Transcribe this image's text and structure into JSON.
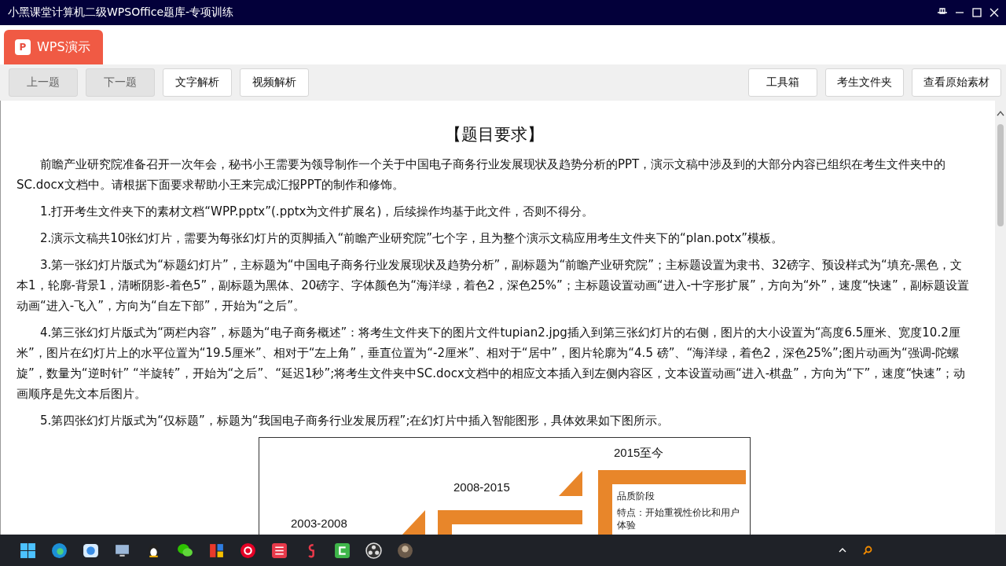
{
  "window": {
    "title": "小黑课堂计算机二级WPSOffice题库-专项训练"
  },
  "app_tab": {
    "label": "WPS演示",
    "icon_letter": "P"
  },
  "toolbar": {
    "left": [
      {
        "label": "上一题",
        "disabled": true
      },
      {
        "label": "下一题",
        "disabled": true
      },
      {
        "label": "文字解析",
        "disabled": false
      },
      {
        "label": "视频解析",
        "disabled": false
      }
    ],
    "right": [
      {
        "label": "工具箱",
        "disabled": false
      },
      {
        "label": "考生文件夹",
        "disabled": false
      },
      {
        "label": "查看原始素材",
        "disabled": false
      }
    ]
  },
  "document": {
    "heading": "【题目要求】",
    "paragraphs": [
      "前瞻产业研究院准备召开一次年会，秘书小王需要为领导制作一个关于中国电子商务行业发展现状及趋势分析的PPT，演示文稿中涉及到的大部分内容已组织在考生文件夹中的SC.docx文档中。请根据下面要求帮助小王来完成汇报PPT的制作和修饰。",
      "1.打开考生文件夹下的素材文档“WPP.pptx”(.pptx为文件扩展名)，后续操作均基于此文件，否则不得分。",
      "2.演示文稿共10张幻灯片，需要为每张幻灯片的页脚插入“前瞻产业研究院”七个字，且为整个演示文稿应用考生文件夹下的“plan.potx”模板。",
      "3.第一张幻灯片版式为“标题幻灯片”，主标题为“中国电子商务行业发展现状及趋势分析”，副标题为“前瞻产业研究院”；主标题设置为隶书、32磅字、预设样式为“填充-黑色，文本1，轮廓-背景1，清晰阴影-着色5”，副标题为黑体、20磅字、字体颜色为“海洋绿，着色2，深色25%”；主标题设置动画“进入-十字形扩展”，方向为“外”，速度“快速”，副标题设置动画“进入-飞入”，方向为“自左下部”，开始为“之后”。",
      "4.第三张幻灯片版式为“两栏内容”，标题为“电子商务概述”：将考生文件夹下的图片文件tupian2.jpg插入到第三张幻灯片的右侧，图片的大小设置为“高度6.5厘米、宽度10.2厘米”，图片在幻灯片上的水平位置为“19.5厘米”、相对于“左上角”，垂直位置为“-2厘米”、相对于“居中”，图片轮廓为“4.5 磅”、“海洋绿，着色2，深色25%”;图片动画为“强调-陀螺旋”，数量为“逆时针” “半旋转”，开始为“之后”、“延迟1秒”;将考生文件夹中SC.docx文档中的相应文本插入到左侧内容区，文本设置动画“进入-棋盘”，方向为“下”，速度“快速”；动画顺序是先文本后图片。",
      "5.第四张幻灯片版式为“仅标题”，标题为“我国电子商务行业发展历程”;在幻灯片中插入智能图形，具体效果如下图所示。"
    ],
    "diagram": {
      "stages": [
        {
          "years": "2003-2008"
        },
        {
          "years": "2008-2015"
        },
        {
          "years": "2015至今",
          "lines": [
            "品质阶段",
            "特点：开始重视性价比和用户体验"
          ]
        }
      ]
    }
  }
}
